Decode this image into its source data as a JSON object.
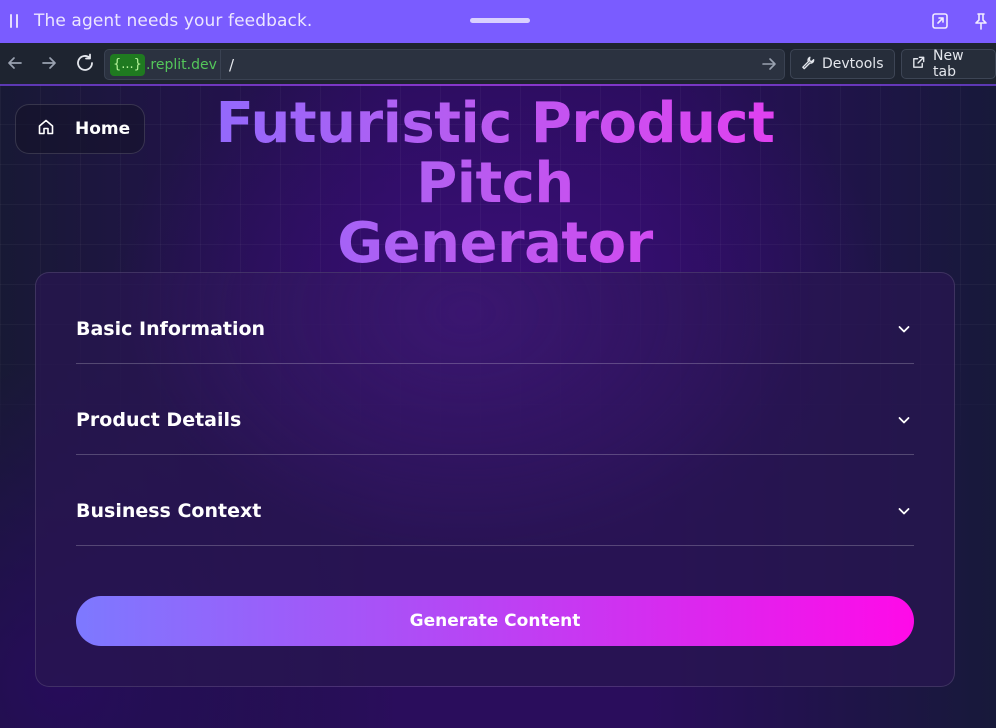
{
  "banner": {
    "message": "The agent needs your feedback.",
    "icons": [
      "pause-icon",
      "drag-handle",
      "open-external-icon",
      "pin-icon"
    ]
  },
  "browser": {
    "host_badge": "{...}",
    "host_domain": ".replit.dev",
    "path": "/",
    "devtools_label": "Devtools",
    "new_tab_label": "New tab",
    "icons": [
      "back-arrow-icon",
      "forward-arrow-icon",
      "reload-icon",
      "go-arrow-icon",
      "wrench-icon",
      "external-link-icon"
    ]
  },
  "page": {
    "home_label": "Home",
    "title_line1": "Futuristic Product Pitch",
    "title_line2": "Generator",
    "sections": [
      {
        "label": "Basic Information"
      },
      {
        "label": "Product Details"
      },
      {
        "label": "Business Context"
      }
    ],
    "generate_label": "Generate Content"
  },
  "colors": {
    "banner": "#7a5cff",
    "browser_bar": "#1e2430",
    "accent_start": "#7d79ff",
    "accent_end": "#ff0ae8",
    "page_bg": "#2a0d5c"
  }
}
